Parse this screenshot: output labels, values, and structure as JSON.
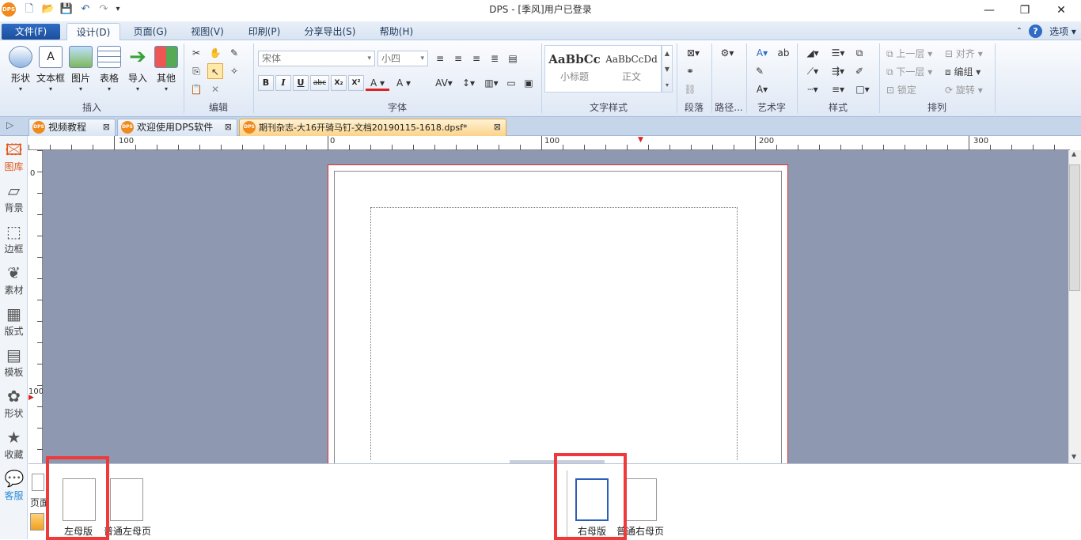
{
  "window": {
    "title": "DPS - [季风]用户已登录",
    "logo_text": "DPS"
  },
  "menu": {
    "file": "文件(F)",
    "design": "设计(D)",
    "page": "页面(G)",
    "view": "视图(V)",
    "print": "印刷(P)",
    "share": "分享导出(S)",
    "help": "帮助(H)",
    "options": "选项"
  },
  "ribbon": {
    "insert": {
      "label": "插入",
      "buttons": [
        "形状",
        "文本框",
        "图片",
        "表格",
        "导入",
        "其他"
      ]
    },
    "edit": {
      "label": "编辑"
    },
    "font": {
      "label": "字体",
      "font_name": "宋体",
      "font_size": "小四",
      "bold": "B",
      "italic": "I",
      "underline": "U",
      "strike": "abc",
      "sub": "X₂",
      "sup": "X²"
    },
    "text_style": {
      "label": "文字样式",
      "style1_preview": "AaBbCc",
      "style1_name": "小标题",
      "style2_preview": "AaBbCcDd",
      "style2_name": "正文"
    },
    "paragraph": {
      "label": "段落"
    },
    "path": {
      "label": "路径..."
    },
    "art_text": {
      "label": "艺术字"
    },
    "style": {
      "label": "样式"
    },
    "arrange": {
      "label": "排列",
      "bring_forward": "上一层",
      "send_backward": "下一层",
      "lock": "锁定",
      "align": "对齐",
      "group": "编组",
      "rotate": "旋转"
    }
  },
  "tabs": [
    {
      "label": "视频教程"
    },
    {
      "label": "欢迎使用DPS软件"
    },
    {
      "label": "期刊杂志-大16开骑马钉-文档20190115-1618.dpsf*"
    }
  ],
  "sidebar": {
    "items": [
      "图库",
      "背景",
      "边框",
      "素材",
      "版式",
      "模板",
      "形状",
      "收藏",
      "客服"
    ]
  },
  "ruler": {
    "h_labels": [
      "100",
      "0",
      "100",
      "200",
      "300"
    ],
    "v_labels": [
      "0",
      "100"
    ]
  },
  "bottom": {
    "page_tab": "页面",
    "left_master": "左母版",
    "normal_left_master": "普通左母页",
    "right_master": "右母版",
    "normal_right_master": "普通右母页"
  }
}
